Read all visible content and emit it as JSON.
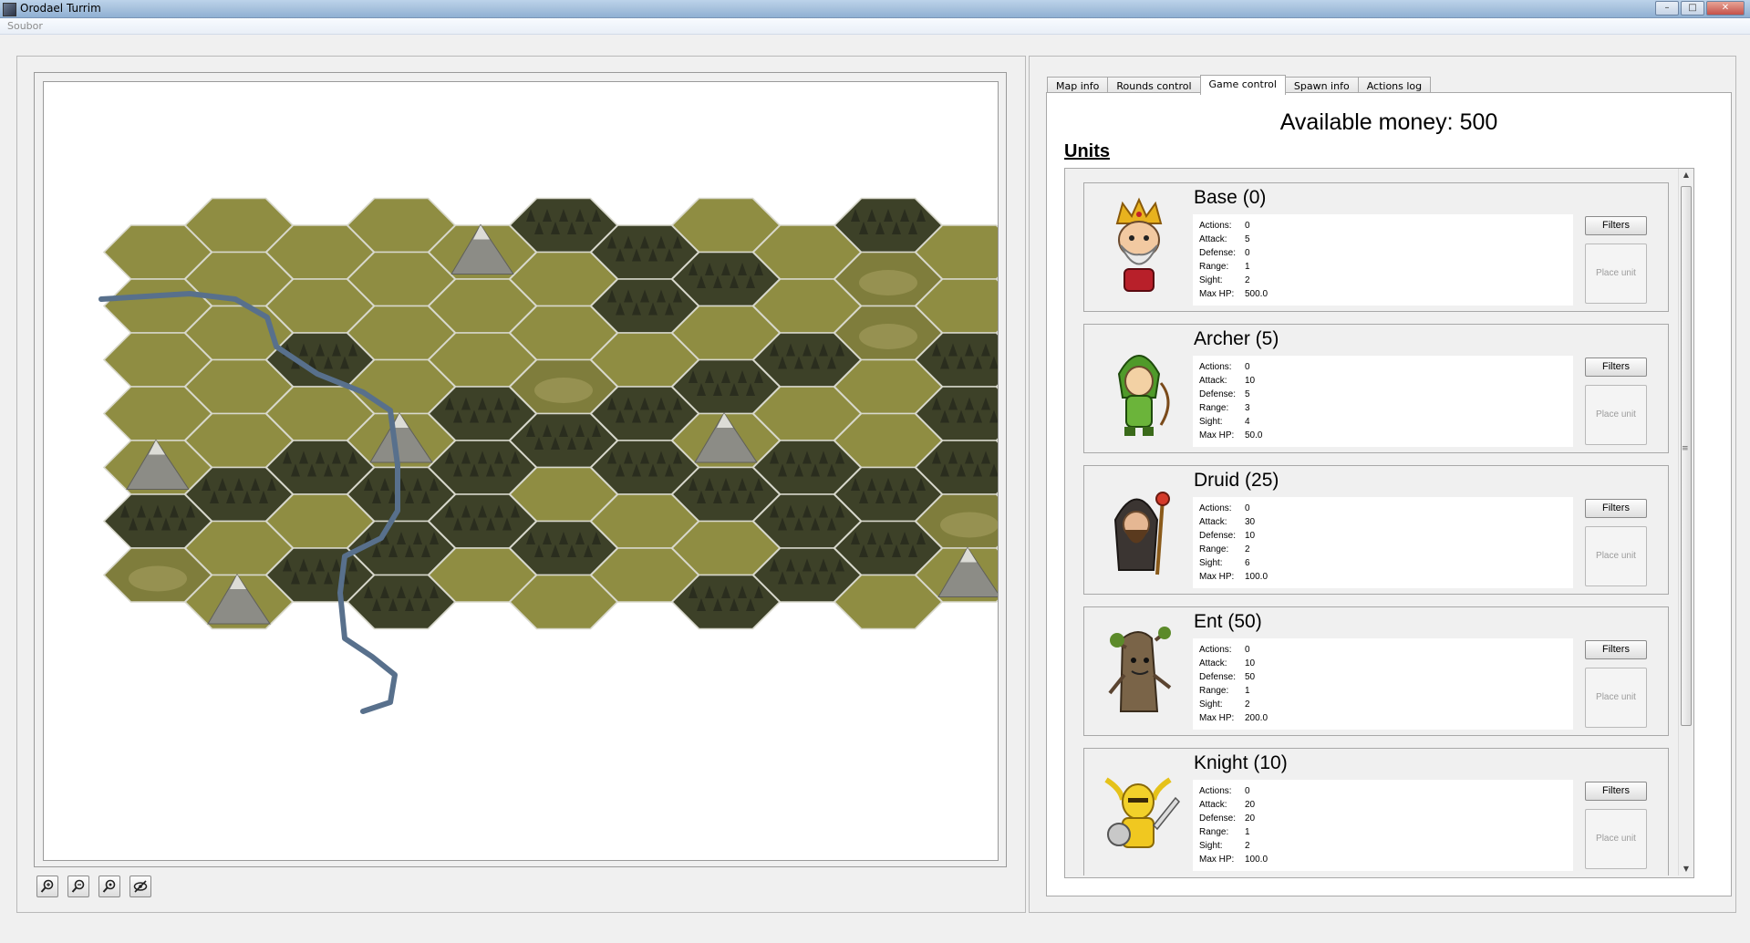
{
  "window": {
    "title": "Orodael Turrim",
    "menu": "Soubor"
  },
  "tabs": [
    {
      "label": "Map info",
      "active": false
    },
    {
      "label": "Rounds control",
      "active": false
    },
    {
      "label": "Game control",
      "active": true
    },
    {
      "label": "Spawn info",
      "active": false
    },
    {
      "label": "Actions log",
      "active": false
    }
  ],
  "game": {
    "money_text": "Available money: 500",
    "units_header": "Units",
    "stat_labels": [
      "Actions:",
      "Attack:",
      "Defense:",
      "Range:",
      "Sight:",
      "Max HP:"
    ],
    "filters_label": "Filters",
    "place_label": "Place unit",
    "units": [
      {
        "name": "Base (0)",
        "stats": [
          "0",
          "5",
          "0",
          "1",
          "2",
          "500.0"
        ],
        "icon": "king-portrait"
      },
      {
        "name": "Archer (5)",
        "stats": [
          "0",
          "10",
          "5",
          "3",
          "4",
          "50.0"
        ],
        "icon": "archer-portrait"
      },
      {
        "name": "Druid (25)",
        "stats": [
          "0",
          "30",
          "10",
          "2",
          "6",
          "100.0"
        ],
        "icon": "druid-portrait"
      },
      {
        "name": "Ent (50)",
        "stats": [
          "0",
          "10",
          "50",
          "1",
          "2",
          "200.0"
        ],
        "icon": "ent-portrait"
      },
      {
        "name": "Knight (10)",
        "stats": [
          "0",
          "20",
          "20",
          "1",
          "2",
          "100.0"
        ],
        "icon": "knight-portrait"
      }
    ]
  },
  "map": {
    "terrain_colors": {
      "grass": "#8f8d42",
      "forest": "#3d4128",
      "hill": "#7f7d3c",
      "mountain": "#8c8c86",
      "river": "#58708c",
      "hex_border": "#d8d8cc"
    },
    "rows": [
      "GGFGFFGFG",
      "GGMFGGGFF",
      "GGGFHGHFF",
      "GGGFGGFGF",
      "GGGGHHMGF",
      "GFGGFFHFF",
      "GGHFGFFFF",
      "GGFFGFFGF",
      "GMFMGFMMF",
      "MFFFFFGMH",
      "FFGFFMMFF",
      "FGFGFHGFF",
      "GFFGFHFFF",
      "HFGGFMMFF",
      "MFGFGMMFF"
    ],
    "river": [
      [
        63,
        238
      ],
      [
        160,
        232
      ],
      [
        210,
        238
      ],
      [
        245,
        258
      ],
      [
        255,
        290
      ],
      [
        300,
        320
      ],
      [
        350,
        340
      ],
      [
        380,
        360
      ],
      [
        388,
        420
      ],
      [
        388,
        470
      ],
      [
        370,
        500
      ],
      [
        330,
        520
      ],
      [
        325,
        560
      ],
      [
        330,
        610
      ],
      [
        360,
        630
      ],
      [
        385,
        650
      ],
      [
        380,
        680
      ],
      [
        350,
        690
      ]
    ]
  },
  "toolbar_icons": [
    "zoom-in-icon",
    "zoom-out-icon",
    "zoom-reset-icon",
    "hide-icon"
  ]
}
